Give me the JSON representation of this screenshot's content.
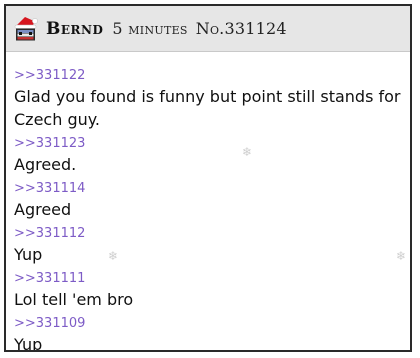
{
  "post": {
    "author": "Bernd",
    "time": "5 minutes",
    "post_number": "No.331124",
    "icon": "santa-hat-flag-icon",
    "replies": [
      {
        "ref": ">>331122",
        "text": "Glad you found is funny but point still stands for Czech guy."
      },
      {
        "ref": ">>331123",
        "text": "Agreed."
      },
      {
        "ref": ">>331114",
        "text": "Agreed"
      },
      {
        "ref": ">>331112",
        "text": "Yup"
      },
      {
        "ref": ">>331111",
        "text": "Lol tell 'em bro"
      },
      {
        "ref": ">>331109",
        "text": "Yup"
      }
    ]
  },
  "decoration": {
    "snowflake_icon": "snowflake-icon",
    "snowflake_glyph": "❄"
  }
}
